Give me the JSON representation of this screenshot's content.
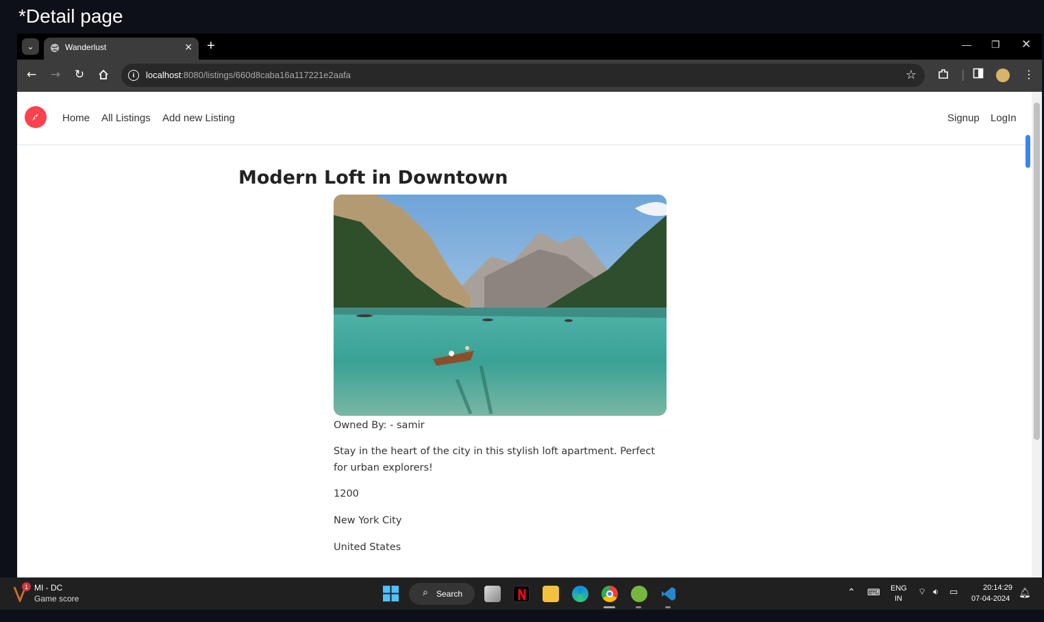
{
  "caption": "*Detail page",
  "browser": {
    "tab_title": "Wanderlust",
    "tab_close": "×",
    "new_tab": "+",
    "url_host": "localhost",
    "url_path": ":8080/listings/660d8caba16a117221e2aafa"
  },
  "navbar": {
    "links": [
      "Home",
      "All Listings",
      "Add new Listing"
    ],
    "right_links": [
      "Signup",
      "LogIn"
    ]
  },
  "listing": {
    "title": "Modern Loft in Downtown",
    "owner": "Owned By: - samir",
    "description": "Stay in the heart of the city in this stylish loft apartment. Perfect for urban explorers!",
    "price": "1200",
    "location": "New York City",
    "country": "United States"
  },
  "taskbar": {
    "widget_title": "MI - DC",
    "widget_subtitle": "Game score",
    "widget_badge": "1",
    "search_label": "Search",
    "lang_top": "ENG",
    "lang_bottom": "IN",
    "time": "20:14:29",
    "date": "07-04-2024"
  },
  "colors": {
    "brand": "#fe424d",
    "browser_chrome": "#3c3c3c",
    "taskbar": "#202020"
  }
}
